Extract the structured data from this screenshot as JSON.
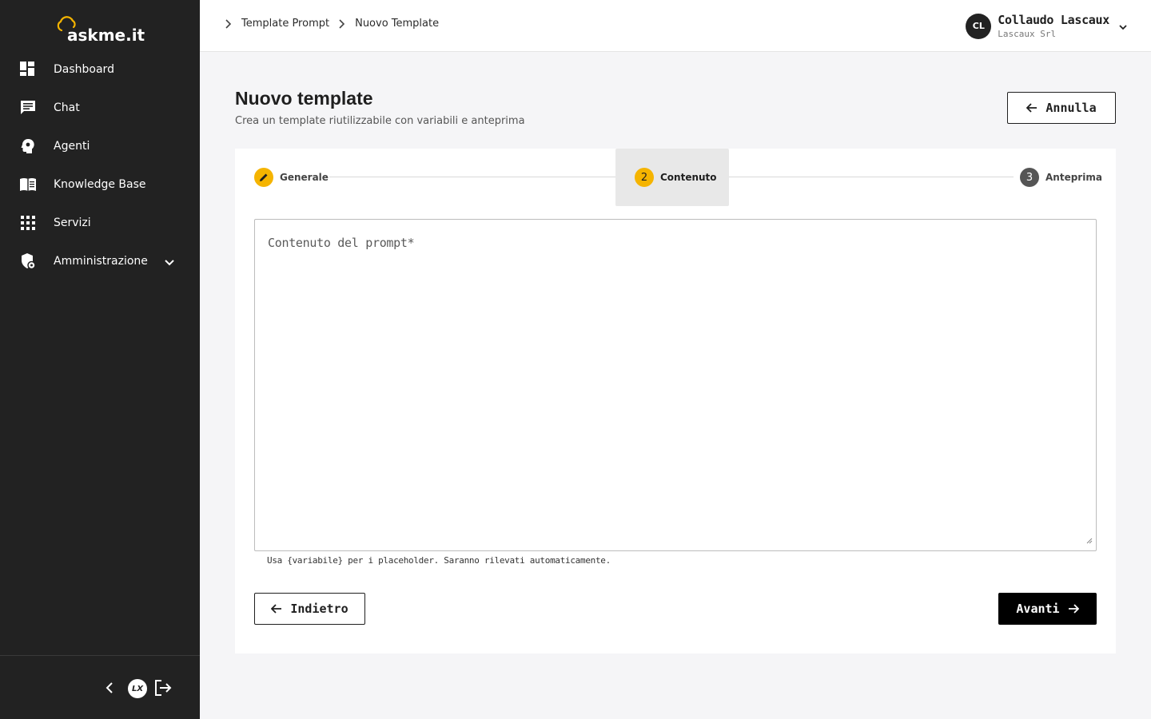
{
  "app": {
    "logo_text": "askme.it",
    "logo_color": "#f5b400"
  },
  "sidebar": {
    "items": [
      {
        "label": "Dashboard",
        "icon": "dashboard-icon"
      },
      {
        "label": "Chat",
        "icon": "chat-icon"
      },
      {
        "label": "Agenti",
        "icon": "agent-head-icon"
      },
      {
        "label": "Knowledge Base",
        "icon": "book-icon"
      },
      {
        "label": "Servizi",
        "icon": "grid-icon"
      },
      {
        "label": "Amministrazione",
        "icon": "admin-shield-icon"
      }
    ],
    "footer_badge": "LX"
  },
  "header": {
    "breadcrumb": [
      "Template Prompt",
      "Nuovo Template"
    ],
    "user": {
      "initials": "CL",
      "name": "Collaudo Lascaux",
      "org": "Lascaux Srl"
    }
  },
  "page": {
    "title": "Nuovo template",
    "subtitle": "Crea un template riutilizzabile con variabili e anteprima",
    "cancel_label": "Annulla"
  },
  "stepper": {
    "steps": [
      {
        "number": "1",
        "label": "Generale",
        "state": "completed"
      },
      {
        "number": "2",
        "label": "Contenuto",
        "state": "active"
      },
      {
        "number": "3",
        "label": "Anteprima",
        "state": "pending"
      }
    ]
  },
  "form": {
    "content_label": "Contenuto del prompt*",
    "content_value": "",
    "hint": "Usa {variabile} per i placeholder. Saranno rilevati automaticamente."
  },
  "actions": {
    "back_label": "Indietro",
    "next_label": "Avanti"
  },
  "colors": {
    "sidebar_bg": "#222222",
    "accent": "#f5b400",
    "primary_button": "#000000"
  }
}
